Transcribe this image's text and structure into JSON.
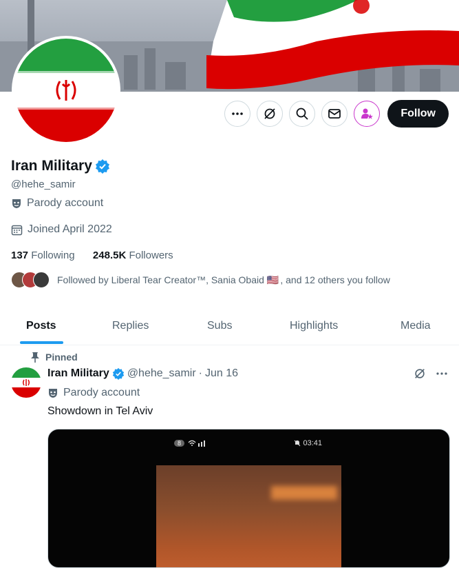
{
  "profile": {
    "name": "Iran Military",
    "handle": "@hehe_samir",
    "parody_label": "Parody account",
    "joined": "Joined April 2022",
    "following_count": "137",
    "following_label": "Following",
    "followers_count": "248.5K",
    "followers_label": "Followers",
    "followed_by_prefix": "Followed by Liberal Tear Creator™, Sania Obaid",
    "followed_by_suffix": ", and 12 others you follow",
    "flag_emoji": "🇺🇸"
  },
  "actions": {
    "follow_label": "Follow",
    "icons": [
      "more-icon",
      "grok-icon",
      "search-icon",
      "message-icon",
      "subscribe-icon"
    ]
  },
  "tabs": [
    "Posts",
    "Replies",
    "Subs",
    "Highlights",
    "Media"
  ],
  "active_tab": "Posts",
  "post": {
    "pinned_label": "Pinned",
    "author": "Iran Military",
    "handle": "@hehe_samir",
    "separator": "·",
    "date": "Jun 16",
    "parody_label": "Parody account",
    "text": "Showdown in Tel Aviv",
    "media_status_left": "8",
    "media_status_time": "03:41"
  },
  "colors": {
    "accent": "#1d9bf0",
    "verified": "#1d9bf0",
    "subscribe": "#c936cc",
    "flag_green": "#239f40",
    "flag_red": "#da0000"
  }
}
